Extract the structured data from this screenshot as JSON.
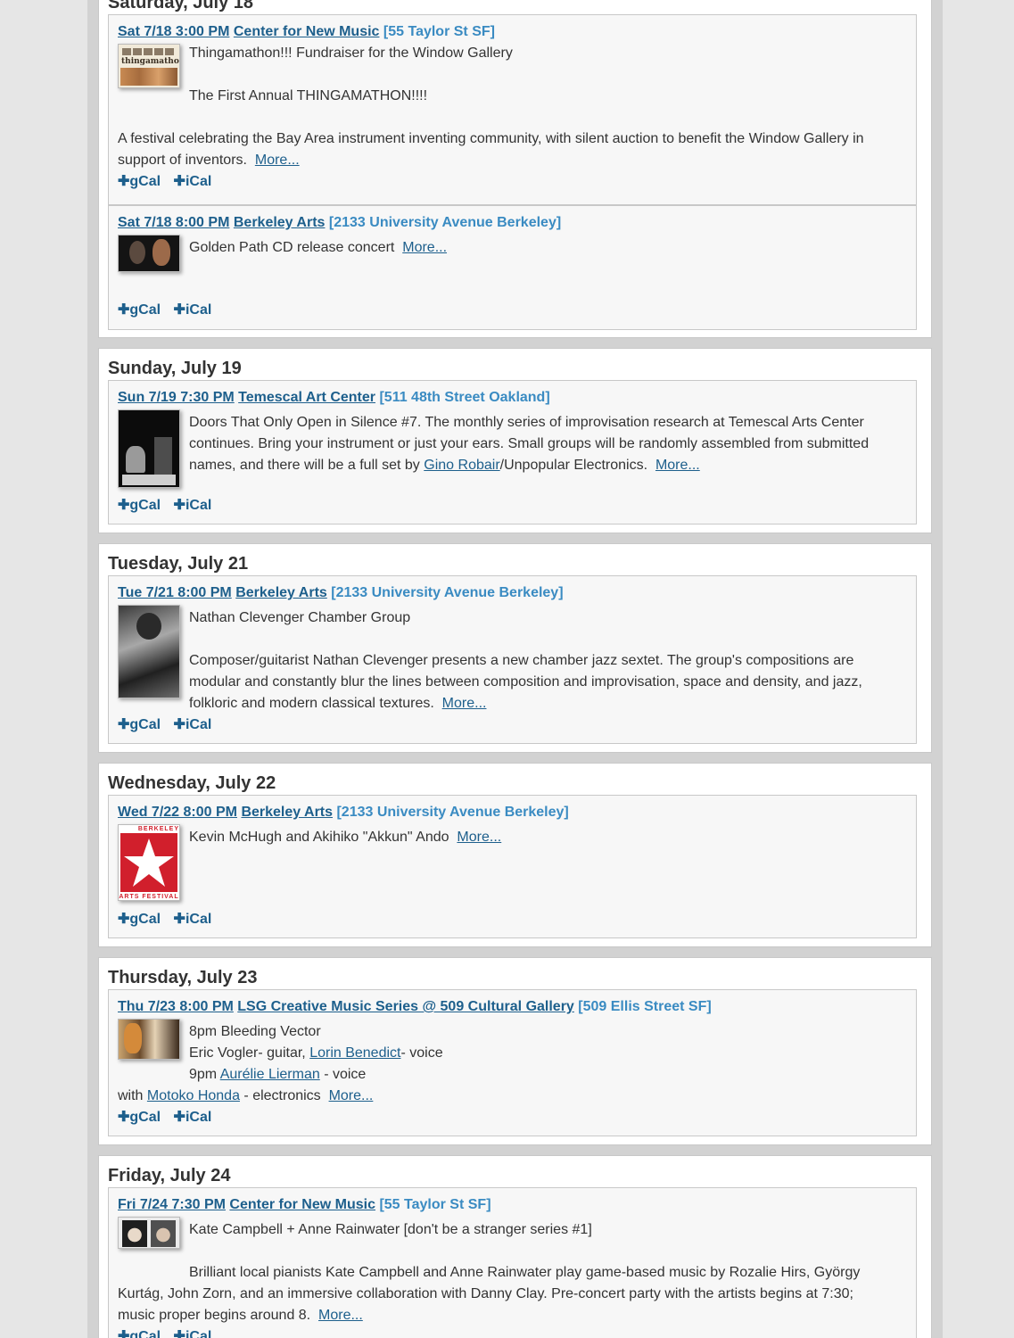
{
  "days": [
    {
      "title": "Saturday, July 18",
      "events": [
        {
          "datetime": "Sat 7/18 3:00 PM",
          "venue": "Center for New Music",
          "address": "[55 Taylor St SF]",
          "thumb_label": "thingamathon",
          "lines": [
            "Thingamathon!!! Fundraiser for the Window Gallery",
            "The First Annual THINGAMATHON!!!!",
            "A festival celebrating the Bay Area instrument inventing community, with silent auction to benefit the Window Gallery in",
            "support of inventors."
          ],
          "more": "More...",
          "gcal": "gCal",
          "ical": "iCal"
        },
        {
          "datetime": "Sat 7/18 8:00 PM",
          "venue": "Berkeley Arts",
          "address": "[2133 University Avenue Berkeley]",
          "lines": [
            "Golden Path CD release concert"
          ],
          "more": "More...",
          "gcal": "gCal",
          "ical": "iCal"
        }
      ]
    },
    {
      "title": "Sunday, July 19",
      "events": [
        {
          "datetime": "Sun 7/19 7:30 PM",
          "venue": "Temescal Art Center",
          "address": "[511 48th Street Oakland]",
          "lines": [
            "Doors That Only Open in Silence #7. The monthly series of improvisation research at Temescal Arts Center",
            "continues. Bring your instrument or just your ears. Small groups will be randomly assembled from submitted",
            "names, and there will be a full set by"
          ],
          "link1": "Gino Robair",
          "after_link1": "/Unpopular Electronics.",
          "more": "More...",
          "gcal": "gCal",
          "ical": "iCal"
        }
      ]
    },
    {
      "title": "Tuesday, July 21",
      "events": [
        {
          "datetime": "Tue 7/21 8:00 PM",
          "venue": "Berkeley Arts",
          "address": "[2133 University Avenue Berkeley]",
          "lines": [
            "Nathan Clevenger Chamber Group",
            "Composer/guitarist Nathan Clevenger presents a new chamber jazz sextet. The group's compositions are",
            "modular and constantly blur the lines between composition and improvisation, space and density, and jazz,",
            "folkloric and modern classical textures."
          ],
          "more": "More...",
          "gcal": "gCal",
          "ical": "iCal"
        }
      ]
    },
    {
      "title": "Wednesday, July 22",
      "events": [
        {
          "datetime": "Wed 7/22 8:00 PM",
          "venue": "Berkeley Arts",
          "address": "[2133 University Avenue Berkeley]",
          "thumb_top": "BERKELEY",
          "thumb_bottom": "ARTS FESTIVAL",
          "lines": [
            "Kevin McHugh and Akihiko \"Akkun\" Ando"
          ],
          "more": "More...",
          "gcal": "gCal",
          "ical": "iCal"
        }
      ]
    },
    {
      "title": "Thursday, July 23",
      "events": [
        {
          "datetime": "Thu 7/23 8:00 PM",
          "venue": "LSG Creative Music Series @ 509 Cultural Gallery",
          "address": "[509 Ellis Street SF]",
          "lines": [
            "8pm Bleeding Vector",
            "Eric Vogler- guitar,",
            "- voice",
            "9pm",
            " - voice",
            "with",
            " - electronics"
          ],
          "link_lorin": "Lorin Benedict",
          "link_aurelie": "Aurélie Lierman",
          "link_motoko": "Motoko Honda",
          "more": "More...",
          "gcal": "gCal",
          "ical": "iCal"
        }
      ]
    },
    {
      "title": "Friday, July 24",
      "events": [
        {
          "datetime": "Fri 7/24 7:30 PM",
          "venue": "Center for New Music",
          "address": "[55 Taylor St SF]",
          "lines": [
            "Kate Campbell + Anne Rainwater [don't be a stranger series #1]",
            "Brilliant local pianists Kate Campbell and Anne Rainwater play game-based music by Rozalie Hirs, György",
            "Kurtág, John Zorn, and an immersive collaboration with Danny Clay. Pre-concert party with the artists begins at 7:30;",
            "music proper begins around 8."
          ],
          "more": "More...",
          "gcal": "gCal",
          "ical": "iCal"
        }
      ]
    }
  ]
}
